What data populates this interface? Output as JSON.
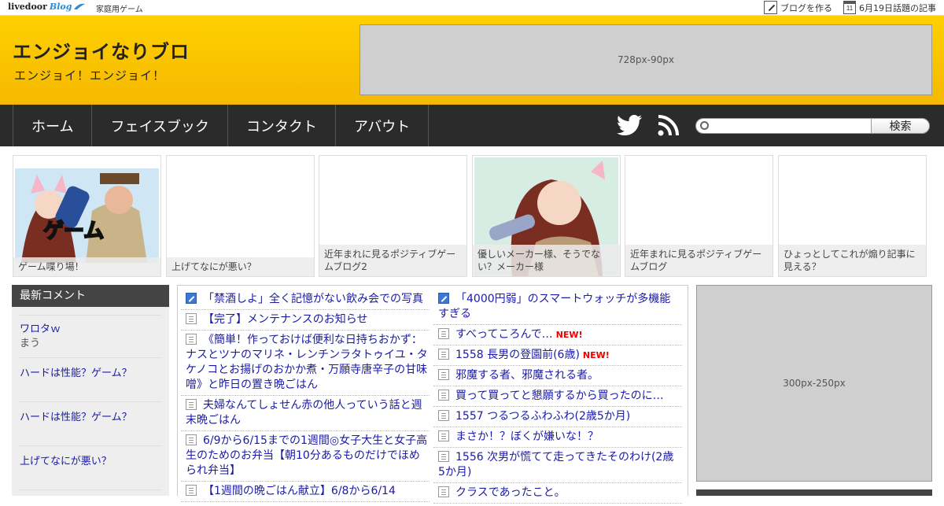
{
  "topbar": {
    "logo_main": "livedoor",
    "logo_blog": "Blog",
    "category": "家庭用ゲーム",
    "create_blog": "ブログを作る",
    "calendar_day": "11",
    "topic": "6月19日話題の記事"
  },
  "header": {
    "title": "エンジョイなりブロ",
    "description": "エンジョイ！エンジョイ！",
    "ad_label": "728px-90px"
  },
  "nav": {
    "items": [
      "ホーム",
      "フェイスブック",
      "コンタクト",
      "アバウト"
    ],
    "search_button": "検索",
    "search_placeholder": ""
  },
  "featured": [
    {
      "caption": "ゲーム喋り場！",
      "thumb_text": "ゲーム"
    },
    {
      "caption": "上げてなにが悪い？"
    },
    {
      "caption": "近年まれに見るポジティブゲームブログ2"
    },
    {
      "caption": "優しいメーカー様、そうでない？メーカー様"
    },
    {
      "caption": "近年まれに見るポジティブゲームブログ"
    },
    {
      "caption": "ひょっとしてこれが煽り記事に見える？"
    }
  ],
  "sidebar": {
    "heading": "最新コメント",
    "comments": [
      {
        "title": "ワロタｗ",
        "user": "まう"
      },
      {
        "title": "ハードは性能？ゲーム？",
        "user": ""
      },
      {
        "title": "ハードは性能？ゲーム？",
        "user": ""
      },
      {
        "title": "上げてなにが悪い？",
        "user": ""
      }
    ]
  },
  "list_left": [
    {
      "icon": "pen",
      "text": "「禁酒しよ」全く記憶がない飲み会での写真"
    },
    {
      "icon": "doc",
      "text": "【完了】メンテナンスのお知らせ"
    },
    {
      "icon": "doc",
      "text": "《簡単！作っておけば便利な日持ちおかず：ナスとツナのマリネ・レンチンラタトゥイユ・タケノコとお揚げのおかか煮・万願寺唐辛子の甘味噌》と昨日の置き晩ごはん"
    },
    {
      "icon": "doc",
      "text": "夫婦なんてしょせん赤の他人っていう話と週末晩ごはん"
    },
    {
      "icon": "doc",
      "text": "6/9から6/15までの1週間◎女子大生と女子高生のためのお弁当【朝10分あるものだけでほめられ弁当】"
    },
    {
      "icon": "doc",
      "text": "【1週間の晩ごはん献立】6/8から6/14"
    }
  ],
  "list_right": [
    {
      "icon": "pen",
      "text": "「4000円弱」のスマートウォッチが多機能すぎる",
      "new": ""
    },
    {
      "icon": "doc",
      "text": "すべってころんで…",
      "new": "NEW!"
    },
    {
      "icon": "doc",
      "text": "1558 長男の登園前(6歳)",
      "new": "NEW!"
    },
    {
      "icon": "doc",
      "text": "邪魔する者、邪魔される者。",
      "new": ""
    },
    {
      "icon": "doc",
      "text": "買って買ってと懇願するから買ったのに…",
      "new": ""
    },
    {
      "icon": "doc",
      "text": "1557 つるつるふわふわ(2歳5か月)",
      "new": ""
    },
    {
      "icon": "doc",
      "text": "まさか！？ぼくが嫌いな！？",
      "new": ""
    },
    {
      "icon": "doc",
      "text": "1556 次男が慌てて走ってきたそのわけ(2歳5か月)",
      "new": ""
    },
    {
      "icon": "doc",
      "text": "クラスであったこと。",
      "new": ""
    }
  ],
  "ad_side_label": "300px-250px",
  "colors": {
    "header": "#ffcc00",
    "nav": "#2b2b2b",
    "link": "#1a1aa6",
    "new_badge": "#ee0000"
  }
}
